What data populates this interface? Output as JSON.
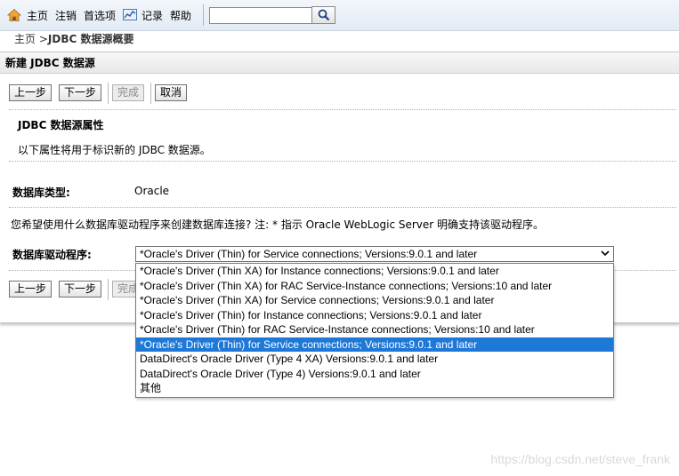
{
  "nav": {
    "home": "主页",
    "logout": "注销",
    "preferences": "首选项",
    "records": "记录",
    "help": "帮助",
    "search_value": ""
  },
  "breadcrumb": {
    "home": "主页",
    "separator": " >",
    "current": "JDBC 数据源概要"
  },
  "panel": {
    "title": "新建 JDBC 数据源",
    "buttons": {
      "back": "上一步",
      "next": "下一步",
      "finish": "完成",
      "cancel": "取消"
    },
    "section_title": "JDBC 数据源属性",
    "section_desc": "以下属性将用于标识新的 JDBC 数据源。",
    "db_type_label": "数据库类型:",
    "db_type_value": "Oracle",
    "question": "您希望使用什么数据库驱动程序来创建数据库连接? 注: * 指示 Oracle WebLogic Server 明确支持该驱动程序。",
    "driver_label": "数据库驱动程序:",
    "driver_selected": "*Oracle's Driver (Thin) for Service connections; Versions:9.0.1 and later",
    "driver_options": [
      "*Oracle's Driver (Thin XA) for Instance connections; Versions:9.0.1 and later",
      "*Oracle's Driver (Thin XA) for RAC Service-Instance connections; Versions:10 and later",
      "*Oracle's Driver (Thin XA) for Service connections; Versions:9.0.1 and later",
      "*Oracle's Driver (Thin) for Instance connections; Versions:9.0.1 and later",
      "*Oracle's Driver (Thin) for RAC Service-Instance connections; Versions:10 and later",
      "*Oracle's Driver (Thin) for Service connections; Versions:9.0.1 and later",
      "DataDirect's Oracle Driver (Type 4 XA) Versions:9.0.1 and later",
      "DataDirect's Oracle Driver (Type 4) Versions:9.0.1 and later",
      "其他"
    ],
    "selected_index": 5,
    "bottom_buttons": {
      "back": "上一步",
      "next": "下一步",
      "finish": "完成"
    }
  },
  "watermark": "https://blog.csdn.net/steve_frank",
  "colors": {
    "selection": "#1e78d8",
    "toolbar_bg": "#e8eef5"
  }
}
